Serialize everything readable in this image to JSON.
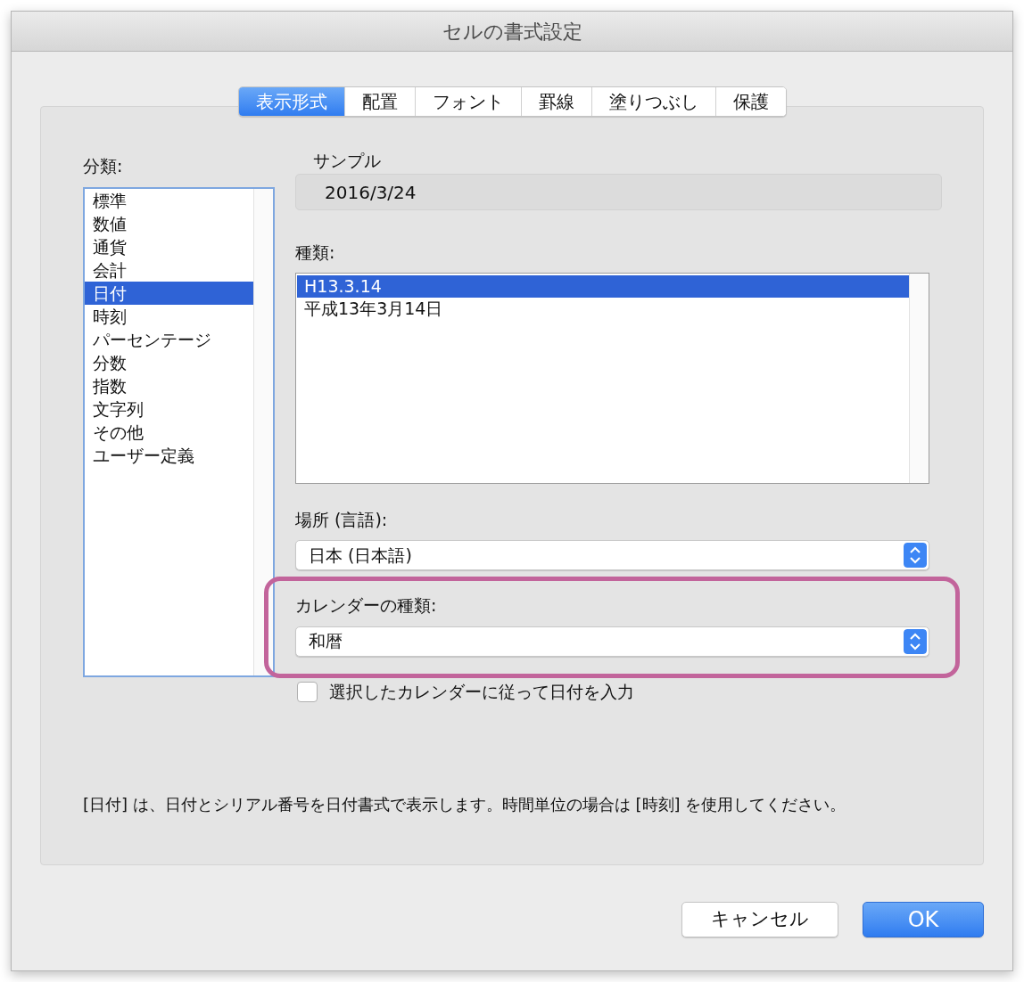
{
  "window": {
    "title": "セルの書式設定"
  },
  "tabs": [
    {
      "label": "表示形式",
      "selected": true
    },
    {
      "label": "配置",
      "selected": false
    },
    {
      "label": "フォント",
      "selected": false
    },
    {
      "label": "罫線",
      "selected": false
    },
    {
      "label": "塗りつぶし",
      "selected": false
    },
    {
      "label": "保護",
      "selected": false
    }
  ],
  "category": {
    "label": "分類:",
    "items": [
      {
        "label": "標準",
        "selected": false
      },
      {
        "label": "数値",
        "selected": false
      },
      {
        "label": "通貨",
        "selected": false
      },
      {
        "label": "会計",
        "selected": false
      },
      {
        "label": "日付",
        "selected": true
      },
      {
        "label": "時刻",
        "selected": false
      },
      {
        "label": "パーセンテージ",
        "selected": false
      },
      {
        "label": "分数",
        "selected": false
      },
      {
        "label": "指数",
        "selected": false
      },
      {
        "label": "文字列",
        "selected": false
      },
      {
        "label": "その他",
        "selected": false
      },
      {
        "label": "ユーザー定義",
        "selected": false
      }
    ]
  },
  "sample": {
    "label": "サンプル",
    "value": "2016/3/24"
  },
  "type": {
    "label": "種類:",
    "items": [
      {
        "label": "H13.3.14",
        "selected": true
      },
      {
        "label": "平成13年3月14日",
        "selected": false
      }
    ]
  },
  "locale": {
    "label": "場所 (言語):",
    "value": "日本 (日本語)"
  },
  "calendar": {
    "label": "カレンダーの種類:",
    "value": "和暦",
    "highlighted": true
  },
  "use_calendar": {
    "label": "選択したカレンダーに従って日付を入力",
    "checked": false
  },
  "description": "[日付] は、日付とシリアル番号を日付書式で表示します。時間単位の場合は [時刻] を使用してください。",
  "buttons": [
    {
      "label": "キャンセル",
      "kind": "normal"
    },
    {
      "label": "OK",
      "kind": "default"
    }
  ]
}
